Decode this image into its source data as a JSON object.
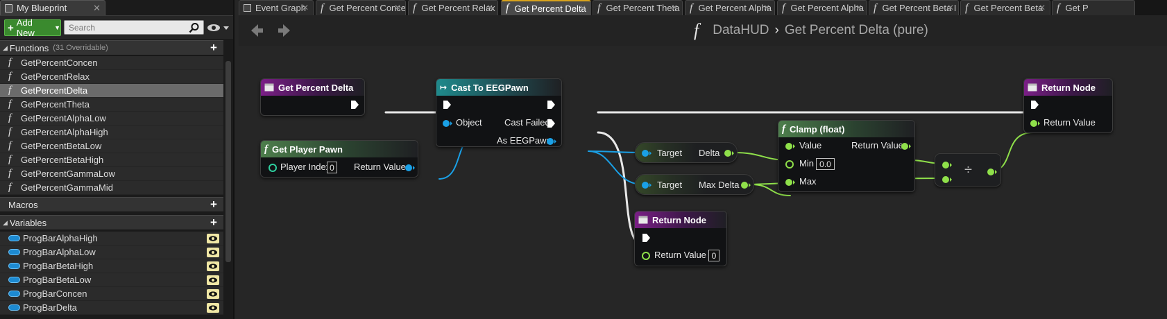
{
  "left_panel": {
    "tab_title": "My Blueprint",
    "add_new_label": "Add New",
    "search_placeholder": "Search",
    "functions": {
      "title": "Functions",
      "subtitle": "(31 Overridable)",
      "items": [
        "GetPercentConcen",
        "GetPercentRelax",
        "GetPercentDelta",
        "GetPercentTheta",
        "GetPercentAlphaLow",
        "GetPercentAlphaHigh",
        "GetPercentBetaLow",
        "GetPercentBetaHigh",
        "GetPercentGammaLow",
        "GetPercentGammaMid"
      ],
      "selected_index": 2
    },
    "macros": {
      "title": "Macros"
    },
    "variables": {
      "title": "Variables",
      "items": [
        "ProgBarAlphaHigh",
        "ProgBarAlphaLow",
        "ProgBarBetaHigh",
        "ProgBarBetaLow",
        "ProgBarConcen",
        "ProgBarDelta"
      ]
    }
  },
  "tabs": [
    {
      "label": "Event Graph"
    },
    {
      "label": "Get Percent Conce"
    },
    {
      "label": "Get Percent Relax"
    },
    {
      "label": "Get Percent Delta"
    },
    {
      "label": "Get Percent Theta"
    },
    {
      "label": "Get Percent Alpha"
    },
    {
      "label": "Get Percent Alpha"
    },
    {
      "label": "Get Percent Beta I"
    },
    {
      "label": "Get Percent Beta"
    },
    {
      "label": "Get P"
    }
  ],
  "breadcrumb": {
    "parent": "DataHUD",
    "current": "Get Percent Delta (pure)"
  },
  "nodes": {
    "entry": {
      "title": "Get Percent Delta"
    },
    "cast": {
      "title": "Cast To EEGPawn",
      "object": "Object",
      "cast_failed": "Cast Failed",
      "as_pawn": "As EEGPawn"
    },
    "get_player_pawn": {
      "title": "Get Player Pawn",
      "player_index": "Player Index",
      "player_index_value": "0",
      "return_value": "Return Value"
    },
    "delta_var": {
      "target": "Target",
      "out": "Delta"
    },
    "max_delta_var": {
      "target": "Target",
      "out": "Max Delta"
    },
    "clamp": {
      "title": "Clamp (float)",
      "value": "Value",
      "min": "Min",
      "min_value": "0.0",
      "max": "Max",
      "return_value": "Return Value"
    },
    "divide": {
      "symbol": "÷"
    },
    "return_main": {
      "title": "Return Node",
      "return_value": "Return Value"
    },
    "return_fail": {
      "title": "Return Node",
      "return_value": "Return Value",
      "return_value_default": "0"
    }
  },
  "colors": {
    "exec_wire": "#ffffff",
    "object_pin": "#1aa0e6",
    "float_pin": "#8fe04a",
    "function_header": "#4d7e4c",
    "entry_header": "#7a1f86",
    "cast_header": "#1f8a8c",
    "active_tab_accent": "#d9a31c",
    "add_button": "#3a8a2e"
  }
}
